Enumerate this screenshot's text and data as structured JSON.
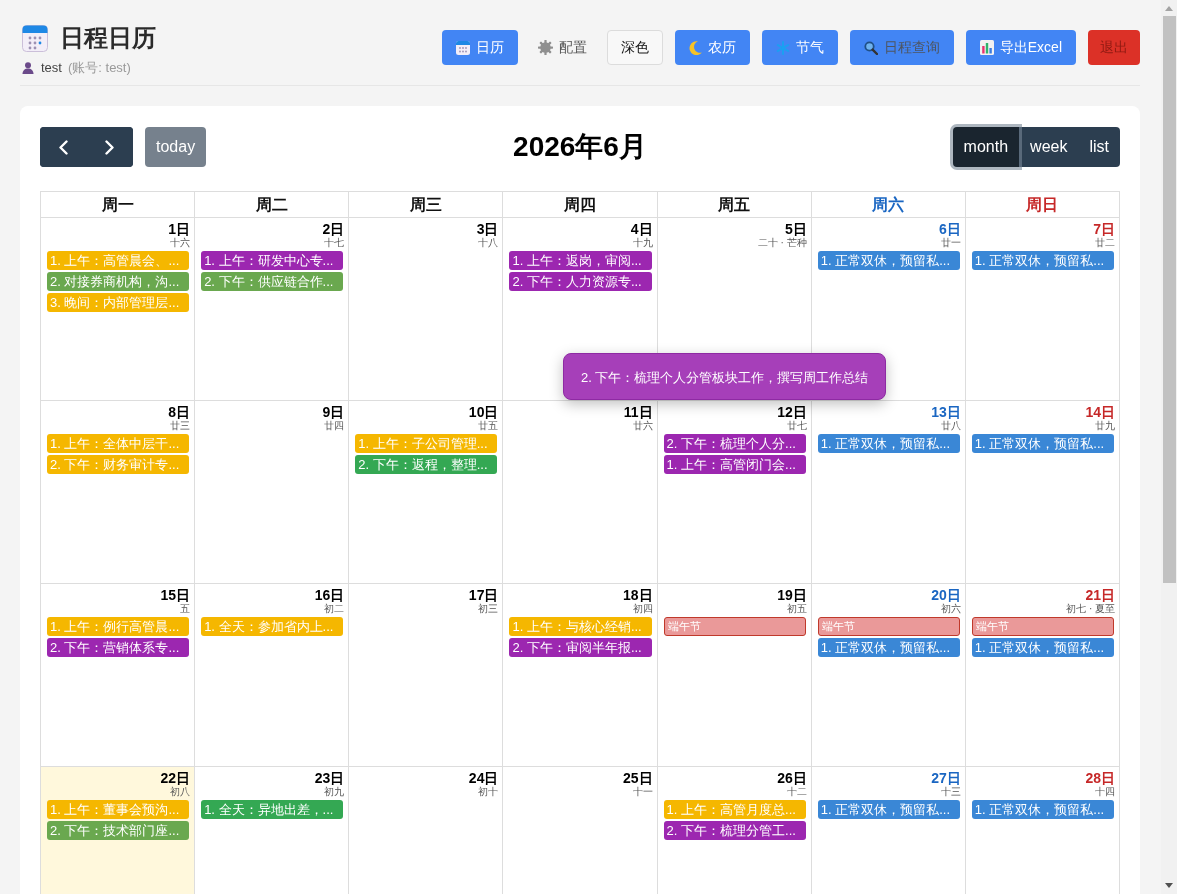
{
  "header": {
    "title": "日程日历",
    "user": "test",
    "account": "(账号: test)",
    "buttons": [
      {
        "label": "日历",
        "kind": "primary"
      },
      {
        "label": "配置",
        "kind": "plain"
      },
      {
        "label": "深色",
        "kind": "outline"
      },
      {
        "label": "农历",
        "kind": "primary"
      },
      {
        "label": "节气",
        "kind": "primary"
      },
      {
        "label": "日程查询",
        "kind": "muted"
      },
      {
        "label": "导出Excel",
        "kind": "primary"
      },
      {
        "label": "退出",
        "kind": "danger"
      }
    ]
  },
  "calendar": {
    "today_button": {
      "label": "today",
      "disabled": true
    },
    "title": "2026年6月",
    "views": [
      {
        "label": "month",
        "selected": true
      },
      {
        "label": "week",
        "selected": false
      },
      {
        "label": "list",
        "selected": false
      }
    ],
    "weekdays": [
      {
        "label": "周一",
        "kind": "weekday"
      },
      {
        "label": "周二",
        "kind": "weekday"
      },
      {
        "label": "周三",
        "kind": "weekday"
      },
      {
        "label": "周四",
        "kind": "weekday"
      },
      {
        "label": "周五",
        "kind": "weekday"
      },
      {
        "label": "周六",
        "kind": "saturday"
      },
      {
        "label": "周日",
        "kind": "sunday"
      }
    ],
    "weeks": [
      {
        "days": [
          {
            "date": "1日",
            "lunar": "十六",
            "today": false,
            "events": [
              {
                "text": "1. 上午：高管晨会、...",
                "kind": "event",
                "color": "#f5b700"
              },
              {
                "text": "2. 对接券商机构，沟...",
                "kind": "event",
                "color": "#6aa84f"
              },
              {
                "text": "3. 晚间：内部管理层...",
                "kind": "event",
                "color": "#f5b700"
              }
            ]
          },
          {
            "date": "2日",
            "lunar": "十七",
            "today": false,
            "events": [
              {
                "text": "1. 上午：研发中心专...",
                "kind": "event",
                "color": "#9c27b0"
              },
              {
                "text": "2. 下午：供应链合作...",
                "kind": "event",
                "color": "#6aa84f"
              }
            ]
          },
          {
            "date": "3日",
            "lunar": "十八",
            "today": false
          },
          {
            "date": "4日",
            "lunar": "十九",
            "today": false,
            "events": [
              {
                "text": "1. 上午：返岗，审阅...",
                "kind": "event",
                "color": "#9c27b0"
              },
              {
                "text": "2. 下午：人力资源专...",
                "kind": "event",
                "color": "#9c27b0"
              }
            ]
          },
          {
            "date": "5日",
            "lunar": "二十 · 芒种",
            "today": false
          },
          {
            "date": "6日",
            "lunar": "廿一",
            "today": false,
            "events": [
              {
                "text": "1. 正常双休，预留私...",
                "kind": "event",
                "color": "#3a87d6"
              }
            ]
          },
          {
            "date": "7日",
            "lunar": "廿二",
            "today": false,
            "events": [
              {
                "text": "1. 正常双休，预留私...",
                "kind": "event",
                "color": "#3a87d6"
              }
            ]
          }
        ]
      },
      {
        "days": [
          {
            "date": "8日",
            "lunar": "廿三",
            "today": false,
            "events": [
              {
                "text": "1. 上午：全体中层干...",
                "kind": "event",
                "color": "#f5b700"
              },
              {
                "text": "2. 下午：财务审计专...",
                "kind": "event",
                "color": "#f5b700"
              }
            ]
          },
          {
            "date": "9日",
            "lunar": "廿四",
            "today": false
          },
          {
            "date": "10日",
            "lunar": "廿五",
            "today": false,
            "events": [
              {
                "text": "1. 上午：子公司管理...",
                "kind": "event",
                "color": "#f5b700"
              },
              {
                "text": "2. 下午：返程，整理...",
                "kind": "event",
                "color": "#34a853"
              }
            ]
          },
          {
            "date": "11日",
            "lunar": "廿六",
            "today": false
          },
          {
            "date": "12日",
            "lunar": "廿七",
            "today": false,
            "events": [
              {
                "text": "2. 下午：梳理个人分...",
                "kind": "event",
                "color": "#9c27b0"
              },
              {
                "text": "1. 上午：高管闭门会...",
                "kind": "event",
                "color": "#9c27b0"
              }
            ]
          },
          {
            "date": "13日",
            "lunar": "廿八",
            "today": false,
            "events": [
              {
                "text": "1. 正常双休，预留私...",
                "kind": "event",
                "color": "#3a87d6"
              }
            ]
          },
          {
            "date": "14日",
            "lunar": "廿九",
            "today": false,
            "events": [
              {
                "text": "1. 正常双休，预留私...",
                "kind": "event",
                "color": "#3a87d6"
              }
            ]
          }
        ]
      },
      {
        "days": [
          {
            "date": "15日",
            "lunar": "五",
            "today": false,
            "events": [
              {
                "text": "1. 上午：例行高管晨...",
                "kind": "event",
                "color": "#f5b700"
              },
              {
                "text": "2. 下午：营销体系专...",
                "kind": "event",
                "color": "#9c27b0"
              }
            ]
          },
          {
            "date": "16日",
            "lunar": "初二",
            "today": false,
            "events": [
              {
                "text": "1. 全天：参加省内上...",
                "kind": "event",
                "color": "#f5b700"
              }
            ]
          },
          {
            "date": "17日",
            "lunar": "初三",
            "today": false
          },
          {
            "date": "18日",
            "lunar": "初四",
            "today": false,
            "events": [
              {
                "text": "1. 上午：与核心经销...",
                "kind": "event",
                "color": "#f5b700"
              },
              {
                "text": "2. 下午：审阅半年报...",
                "kind": "event",
                "color": "#9c27b0"
              }
            ]
          },
          {
            "date": "19日",
            "lunar": "初五",
            "today": false,
            "events": [
              {
                "text": "端午节",
                "kind": "holiday",
                "color": "#ea9999"
              }
            ]
          },
          {
            "date": "20日",
            "lunar": "初六",
            "today": false,
            "events": [
              {
                "text": "端午节",
                "kind": "holiday",
                "color": "#ea9999"
              },
              {
                "text": "1. 正常双休，预留私...",
                "kind": "event",
                "color": "#3a87d6"
              }
            ]
          },
          {
            "date": "21日",
            "lunar": "初七 · 夏至",
            "today": false,
            "events": [
              {
                "text": "端午节",
                "kind": "holiday",
                "color": "#ea9999"
              },
              {
                "text": "1. 正常双休，预留私...",
                "kind": "event",
                "color": "#3a87d6"
              }
            ]
          }
        ]
      },
      {
        "days": [
          {
            "date": "22日",
            "lunar": "初八",
            "today": true,
            "events": [
              {
                "text": "1. 上午：董事会预沟...",
                "kind": "event",
                "color": "#f5b700"
              },
              {
                "text": "2. 下午：技术部门座...",
                "kind": "event",
                "color": "#6aa84f"
              }
            ]
          },
          {
            "date": "23日",
            "lunar": "初九",
            "today": false,
            "events": [
              {
                "text": "1. 全天：异地出差，...",
                "kind": "event",
                "color": "#34a853"
              }
            ]
          },
          {
            "date": "24日",
            "lunar": "初十",
            "today": false
          },
          {
            "date": "25日",
            "lunar": "十一",
            "today": false
          },
          {
            "date": "26日",
            "lunar": "十二",
            "today": false,
            "events": [
              {
                "text": "1. 上午：高管月度总...",
                "kind": "event",
                "color": "#f5b700"
              },
              {
                "text": "2. 下午：梳理分管工...",
                "kind": "event",
                "color": "#9c27b0"
              }
            ]
          },
          {
            "date": "27日",
            "lunar": "十三",
            "today": false,
            "events": [
              {
                "text": "1. 正常双休，预留私...",
                "kind": "event",
                "color": "#3a87d6"
              }
            ]
          },
          {
            "date": "28日",
            "lunar": "十四",
            "today": false,
            "events": [
              {
                "text": "1. 正常双休，预留私...",
                "kind": "event",
                "color": "#3a87d6"
              }
            ]
          }
        ]
      }
    ],
    "tooltip": "2. 下午：梳理个人分管板块工作，撰写周工作总结"
  }
}
